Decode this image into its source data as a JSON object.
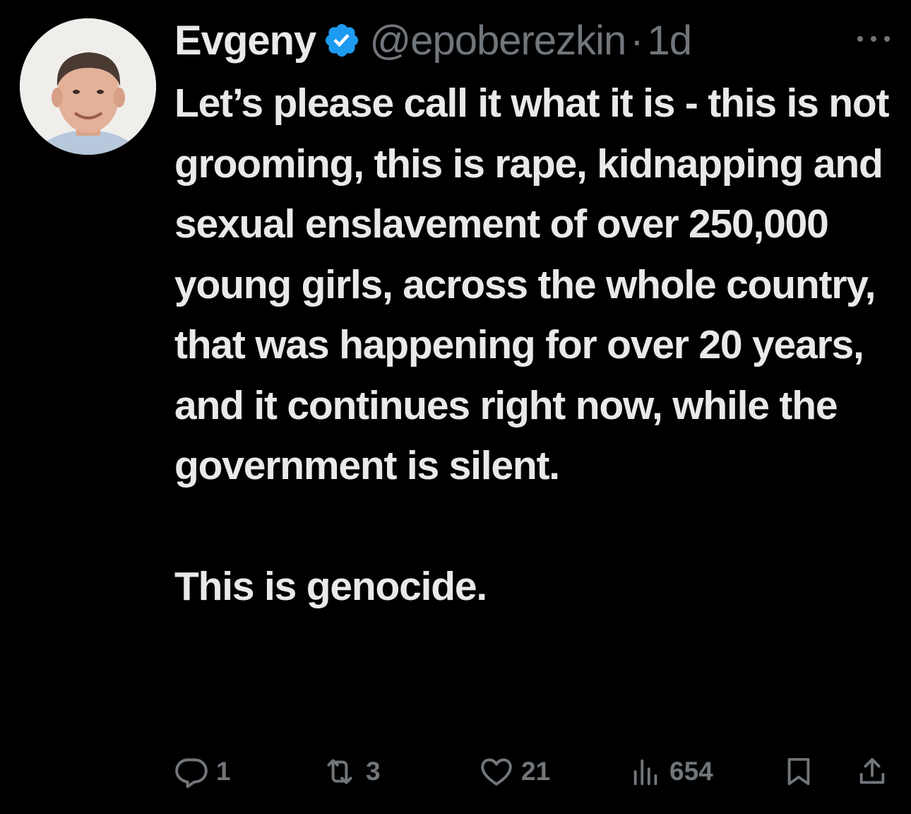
{
  "tweet": {
    "author": {
      "display_name": "Evgeny",
      "handle": "@epoberezkin",
      "verified": true
    },
    "separator": "·",
    "timestamp": "1d",
    "text": "Let’s please call it what it is - this is not grooming, this is rape, kidnapping and sexual enslavement of over 250,000 young girls, across the whole country, that was happening for over 20 years, and it continues right now, while the government is silent.\n\nThis is genocide.",
    "actions": {
      "reply_count": "1",
      "retweet_count": "3",
      "like_count": "21",
      "view_count": "654"
    }
  },
  "icons": {
    "avatar": "avatar",
    "verified": "verified-badge-icon",
    "more": "more-icon",
    "reply": "reply-icon",
    "retweet": "retweet-icon",
    "like": "heart-icon",
    "views": "views-icon",
    "bookmark": "bookmark-icon",
    "share": "share-icon"
  },
  "colors": {
    "background": "#000000",
    "text": "#e7e9ea",
    "muted": "#71767b",
    "verified": "#1d9bf0"
  }
}
